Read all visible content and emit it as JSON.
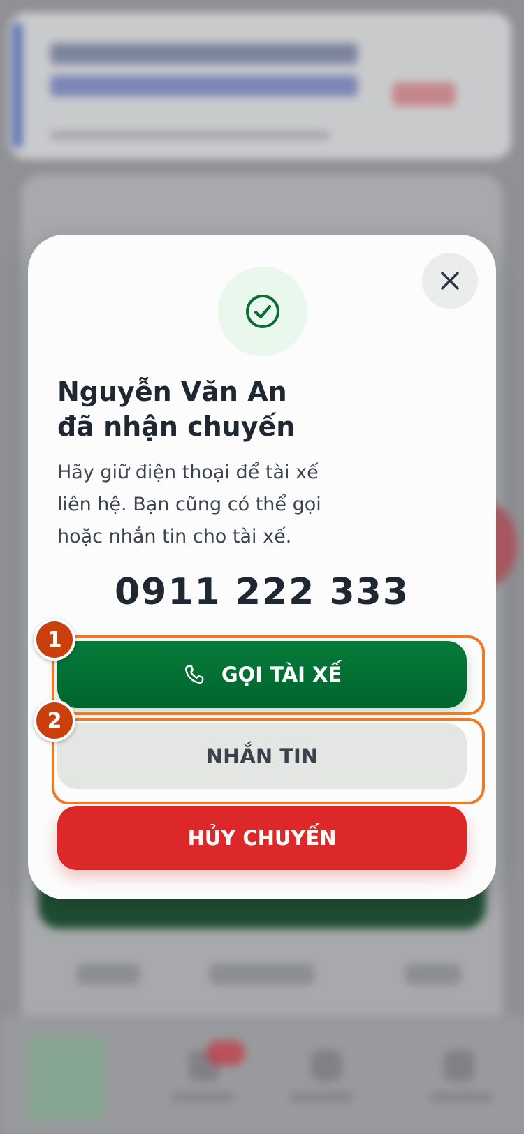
{
  "dialog": {
    "title_line1": "Nguyễn Văn An",
    "title_line2": "đã nhận chuyến",
    "description_line1": "Hãy giữ điện thoại để tài xế",
    "description_line2": "liên hệ. Bạn cũng có thể gọi",
    "description_line3": "hoặc nhắn tin cho tài xế.",
    "phone": "0911 222 333",
    "call_label": "GỌI TÀI XẾ",
    "message_label": "NHẮN TIN",
    "cancel_label": "HỦY CHUYẾN"
  },
  "annotations": {
    "marker_1": "1",
    "marker_2": "2"
  },
  "icons": {
    "close": "close-icon",
    "success": "check-circle-icon",
    "call": "phone-icon"
  },
  "colors": {
    "primary_green": "#00652e",
    "cancel_red": "#dc2828",
    "highlight_orange": "#ef7a26",
    "marker": "#c9400d"
  }
}
